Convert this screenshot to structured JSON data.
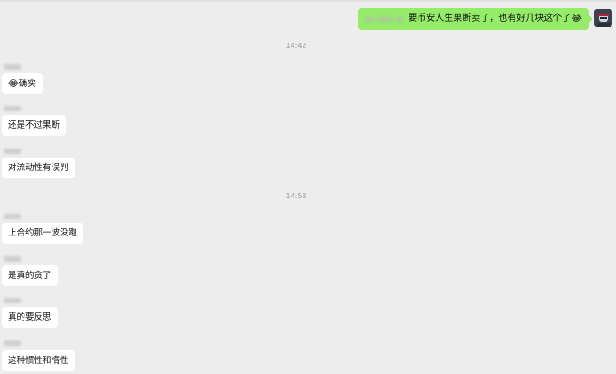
{
  "outgoing_message": {
    "text": "要币安人生果断卖了，也有好几块这个了",
    "emoji": "😂"
  },
  "timestamps": [
    "14:42",
    "14:58"
  ],
  "incoming_messages": [
    {
      "text": "确实",
      "emoji": "😂"
    },
    {
      "text": "还是不过果断"
    },
    {
      "text": "对流动性有误判"
    },
    {
      "text": "上合约那一波没跑"
    },
    {
      "text": "是真的贪了"
    },
    {
      "text": "真的要反思"
    },
    {
      "text": "这种惯性和惰性"
    }
  ],
  "colors": {
    "background": "#ededed",
    "outgoing_bubble": "#95ec69",
    "incoming_bubble": "#ffffff",
    "timestamp_text": "#9a9a9a"
  },
  "icons": {
    "avatar": "ninja-avatar-icon"
  }
}
